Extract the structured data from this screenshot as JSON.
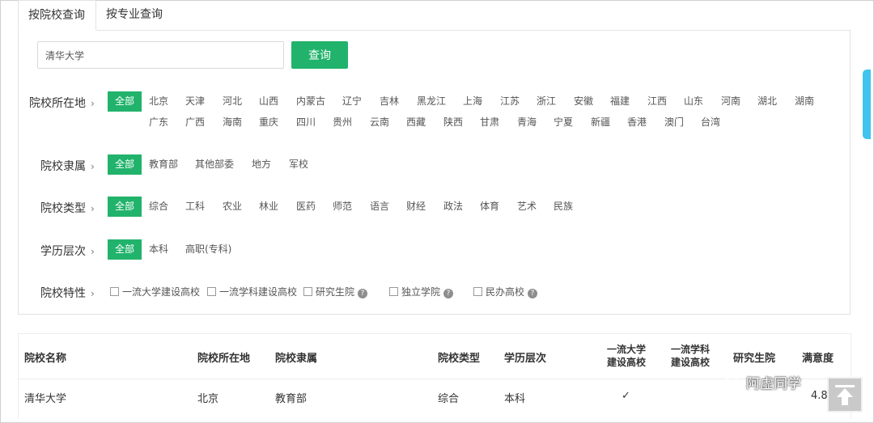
{
  "tabs": [
    {
      "label": "按院校查询"
    },
    {
      "label": "按专业查询"
    }
  ],
  "search": {
    "value": "清华大学",
    "button_label": "查询"
  },
  "filters": {
    "location": {
      "label": "院校所在地",
      "options": [
        "全部",
        "北京",
        "天津",
        "河北",
        "山西",
        "内蒙古",
        "辽宁",
        "吉林",
        "黑龙江",
        "上海",
        "江苏",
        "浙江",
        "安徽",
        "福建",
        "江西",
        "山东",
        "河南",
        "湖北",
        "湖南",
        "广东",
        "广西",
        "海南",
        "重庆",
        "四川",
        "贵州",
        "云南",
        "西藏",
        "陕西",
        "甘肃",
        "青海",
        "宁夏",
        "新疆",
        "香港",
        "澳门",
        "台湾"
      ]
    },
    "affiliation": {
      "label": "院校隶属",
      "options": [
        "全部",
        "教育部",
        "其他部委",
        "地方",
        "军校"
      ]
    },
    "type": {
      "label": "院校类型",
      "options": [
        "全部",
        "综合",
        "工科",
        "农业",
        "林业",
        "医药",
        "师范",
        "语言",
        "财经",
        "政法",
        "体育",
        "艺术",
        "民族"
      ]
    },
    "level": {
      "label": "学历层次",
      "options": [
        "全部",
        "本科",
        "高职(专科)"
      ]
    },
    "features": {
      "label": "院校特性",
      "options": [
        "一流大学建设高校",
        "一流学科建设高校",
        "研究生院",
        "独立学院",
        "民办高校"
      ]
    }
  },
  "table": {
    "headers": [
      "院校名称",
      "院校所在地",
      "院校隶属",
      "院校类型",
      "学历层次",
      "一流大学\n建设高校",
      "一流学科\n建设高校",
      "研究生院",
      "满意度"
    ],
    "rows": [
      {
        "name": "清华大学",
        "location": "北京",
        "affiliation": "教育部",
        "type": "综合",
        "level": "本科",
        "first_class_univ": "✓",
        "satisfaction": "4.8"
      }
    ]
  },
  "watermark": {
    "text": "阿虚同学"
  },
  "colors": {
    "accent": "#21b36b",
    "scroll_tab": "#40c4ee"
  },
  "icons": {
    "chevron": "chevron-right-icon",
    "help": "question-circle-icon",
    "back_to_top": "arrow-up-icon"
  }
}
